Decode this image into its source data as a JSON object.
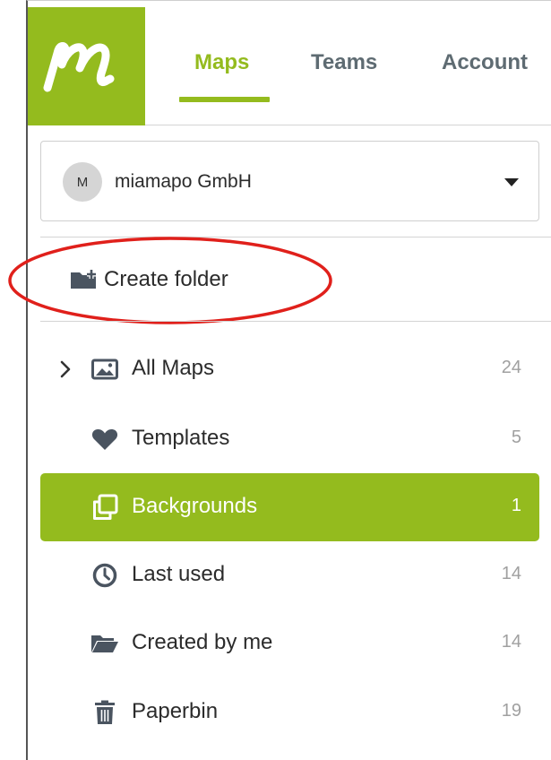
{
  "colors": {
    "brand": "#94bb1e",
    "tab_inactive": "#5e6b72",
    "count": "#a0a0a0",
    "annotation": "#e0201b"
  },
  "header": {
    "logo_icon": "miamapo-logo",
    "tabs": [
      {
        "label": "Maps",
        "active": true
      },
      {
        "label": "Teams",
        "active": false
      },
      {
        "label": "Account",
        "active": false
      }
    ]
  },
  "org_selector": {
    "avatar_initial": "M",
    "name": "miamapo GmbH",
    "icon": "caret-down-icon"
  },
  "actions": {
    "create_folder": {
      "label": "Create folder",
      "icon": "folder-plus-icon",
      "highlighted": true
    }
  },
  "nav": {
    "items": [
      {
        "label": "All Maps",
        "count": "24",
        "icon": "image-icon",
        "expandable": true,
        "active": false
      },
      {
        "label": "Templates",
        "count": "5",
        "icon": "heart-icon",
        "active": false
      },
      {
        "label": "Backgrounds",
        "count": "1",
        "icon": "layers-icon",
        "active": true
      },
      {
        "label": "Last used",
        "count": "14",
        "icon": "clock-icon",
        "active": false
      },
      {
        "label": "Created by me",
        "count": "14",
        "icon": "folder-open-icon",
        "active": false
      },
      {
        "label": "Paperbin",
        "count": "19",
        "icon": "trash-icon",
        "active": false
      }
    ]
  }
}
